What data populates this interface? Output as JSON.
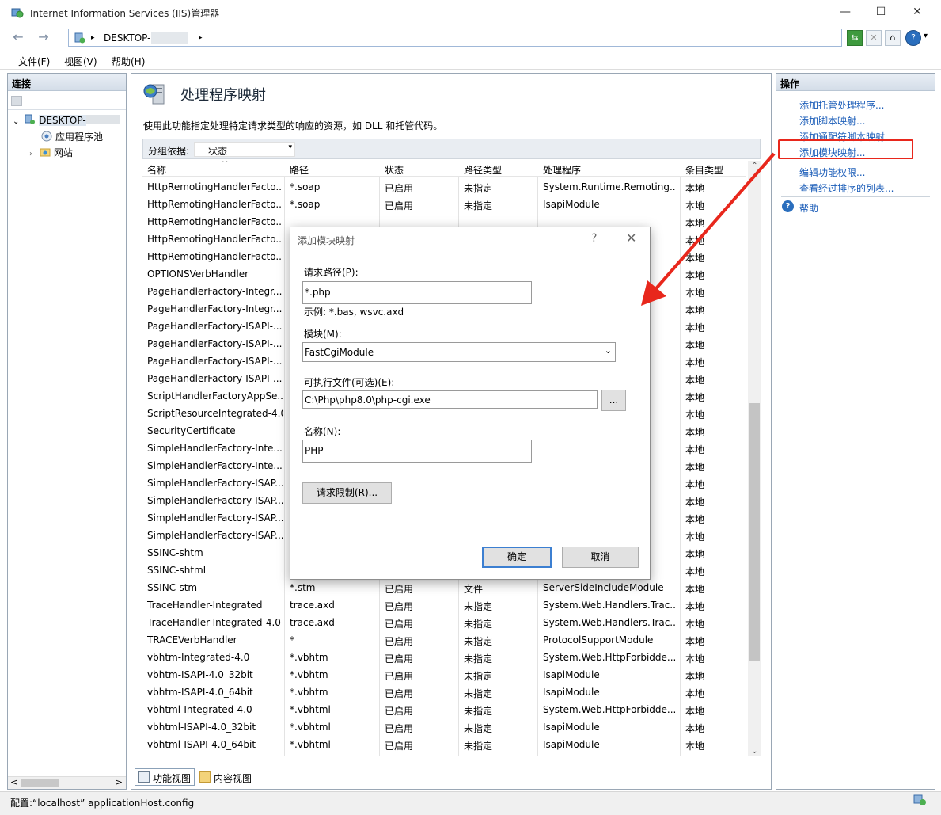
{
  "window": {
    "title": "Internet Information Services (IIS)管理器",
    "minimize": "—",
    "maximize": "☐",
    "close": "✕"
  },
  "address": {
    "back": "←",
    "forward": "→",
    "crumb_arrow": "▸",
    "crumb": "DESKTOP-",
    "help_menu": "?",
    "help_arrow": "▾"
  },
  "menu": {
    "file": "文件(F)",
    "view": "视图(V)",
    "help": "帮助(H)"
  },
  "connections": {
    "title": "连接",
    "server": "DESKTOP-",
    "app_pools": "应用程序池",
    "sites": "网站",
    "scroll_left": "<",
    "scroll_right": ">"
  },
  "page": {
    "title": "处理程序映射",
    "description": "使用此功能指定处理特定请求类型的响应的资源，如 DLL 和托管代码。",
    "group_label": "分组依据:",
    "group_value": "状态",
    "group_arrow": "▾"
  },
  "table": {
    "headers": [
      "名称",
      "路径",
      "状态",
      "路径类型",
      "处理程序",
      "条目类型"
    ],
    "sort_indicator": "^",
    "rows": [
      [
        "HttpRemotingHandlerFacto...",
        "*.soap",
        "已启用",
        "未指定",
        "System.Runtime.Remoting....",
        "本地"
      ],
      [
        "HttpRemotingHandlerFacto...",
        "*.soap",
        "已启用",
        "未指定",
        "IsapiModule",
        "本地"
      ],
      [
        "HttpRemotingHandlerFacto...",
        "",
        "",
        "",
        "",
        "本地"
      ],
      [
        "HttpRemotingHandlerFacto...",
        "",
        "",
        "",
        "",
        "本地"
      ],
      [
        "HttpRemotingHandlerFacto...",
        "",
        "",
        "",
        "",
        "本地"
      ],
      [
        "OPTIONSVerbHandler",
        "",
        "",
        "",
        "le",
        "本地"
      ],
      [
        "PageHandlerFactory-Integr...",
        "",
        "",
        "",
        "ndl...",
        "本地"
      ],
      [
        "PageHandlerFactory-Integr...",
        "",
        "",
        "",
        "ndl...",
        "本地"
      ],
      [
        "PageHandlerFactory-ISAPI-...",
        "",
        "",
        "",
        "",
        "本地"
      ],
      [
        "PageHandlerFactory-ISAPI-...",
        "",
        "",
        "",
        "",
        "本地"
      ],
      [
        "PageHandlerFactory-ISAPI-...",
        "",
        "",
        "",
        "",
        "本地"
      ],
      [
        "PageHandlerFactory-ISAPI-...",
        "",
        "",
        "",
        "",
        "本地"
      ],
      [
        "ScriptHandlerFactoryAppSe...",
        "",
        "",
        "",
        "ces...",
        "本地"
      ],
      [
        "ScriptResourceIntegrated-4.0",
        "",
        "",
        "",
        "cri...",
        "本地"
      ],
      [
        "SecurityCertificate",
        "",
        "",
        "",
        "",
        "本地"
      ],
      [
        "SimpleHandlerFactory-Inte...",
        "",
        "",
        "",
        "an...",
        "本地"
      ],
      [
        "SimpleHandlerFactory-Inte...",
        "",
        "",
        "",
        "an...",
        "本地"
      ],
      [
        "SimpleHandlerFactory-ISAP...",
        "",
        "",
        "",
        "",
        "本地"
      ],
      [
        "SimpleHandlerFactory-ISAP...",
        "",
        "",
        "",
        "",
        "本地"
      ],
      [
        "SimpleHandlerFactory-ISAP...",
        "",
        "",
        "",
        "",
        "本地"
      ],
      [
        "SimpleHandlerFactory-ISAP...",
        "",
        "",
        "",
        "",
        "本地"
      ],
      [
        "SSINC-shtm",
        "",
        "",
        "",
        "le",
        "本地"
      ],
      [
        "SSINC-shtml",
        "",
        "",
        "",
        "le",
        "本地"
      ],
      [
        "SSINC-stm",
        "*.stm",
        "已启用",
        "文件",
        "ServerSideIncludeModule",
        "本地"
      ],
      [
        "TraceHandler-Integrated",
        "trace.axd",
        "已启用",
        "未指定",
        "System.Web.Handlers.Trac...",
        "本地"
      ],
      [
        "TraceHandler-Integrated-4.0",
        "trace.axd",
        "已启用",
        "未指定",
        "System.Web.Handlers.Trac...",
        "本地"
      ],
      [
        "TRACEVerbHandler",
        "*",
        "已启用",
        "未指定",
        "ProtocolSupportModule",
        "本地"
      ],
      [
        "vbhtm-Integrated-4.0",
        "*.vbhtm",
        "已启用",
        "未指定",
        "System.Web.HttpForbidde...",
        "本地"
      ],
      [
        "vbhtm-ISAPI-4.0_32bit",
        "*.vbhtm",
        "已启用",
        "未指定",
        "IsapiModule",
        "本地"
      ],
      [
        "vbhtm-ISAPI-4.0_64bit",
        "*.vbhtm",
        "已启用",
        "未指定",
        "IsapiModule",
        "本地"
      ],
      [
        "vbhtml-Integrated-4.0",
        "*.vbhtml",
        "已启用",
        "未指定",
        "System.Web.HttpForbidde...",
        "本地"
      ],
      [
        "vbhtml-ISAPI-4.0_32bit",
        "*.vbhtml",
        "已启用",
        "未指定",
        "IsapiModule",
        "本地"
      ],
      [
        "vbhtml-ISAPI-4.0_64bit",
        "*.vbhtml",
        "已启用",
        "未指定",
        "IsapiModule",
        "本地"
      ]
    ]
  },
  "view_tabs": {
    "features": "功能视图",
    "content": "内容视图"
  },
  "actions": {
    "title": "操作",
    "items": [
      "添加托管处理程序...",
      "添加脚本映射...",
      "添加通配符脚本映射...",
      "添加模块映射...",
      "编辑功能权限...",
      "查看经过排序的列表...",
      "帮助"
    ],
    "help_glyph": "?"
  },
  "status": {
    "text": "配置:“localhost” applicationHost.config"
  },
  "dialog": {
    "title": "添加模块映射",
    "help": "?",
    "close": "✕",
    "request_path_label": "请求路径(P):",
    "request_path_value": "*.php",
    "example": "示例: *.bas, wsvc.axd",
    "module_label": "模块(M):",
    "module_value": "FastCgiModule",
    "module_arrow": "⌄",
    "exe_label": "可执行文件(可选)(E):",
    "exe_value": "C:\\Php\\php8.0\\php-cgi.exe",
    "browse": "...",
    "name_label": "名称(N):",
    "name_value": "PHP",
    "restrictions": "请求限制(R)...",
    "ok": "确定",
    "cancel": "取消"
  },
  "colors": {
    "highlight_box": "#e8271c",
    "arrow": "#e8271c",
    "link": "#1a5cb8"
  }
}
